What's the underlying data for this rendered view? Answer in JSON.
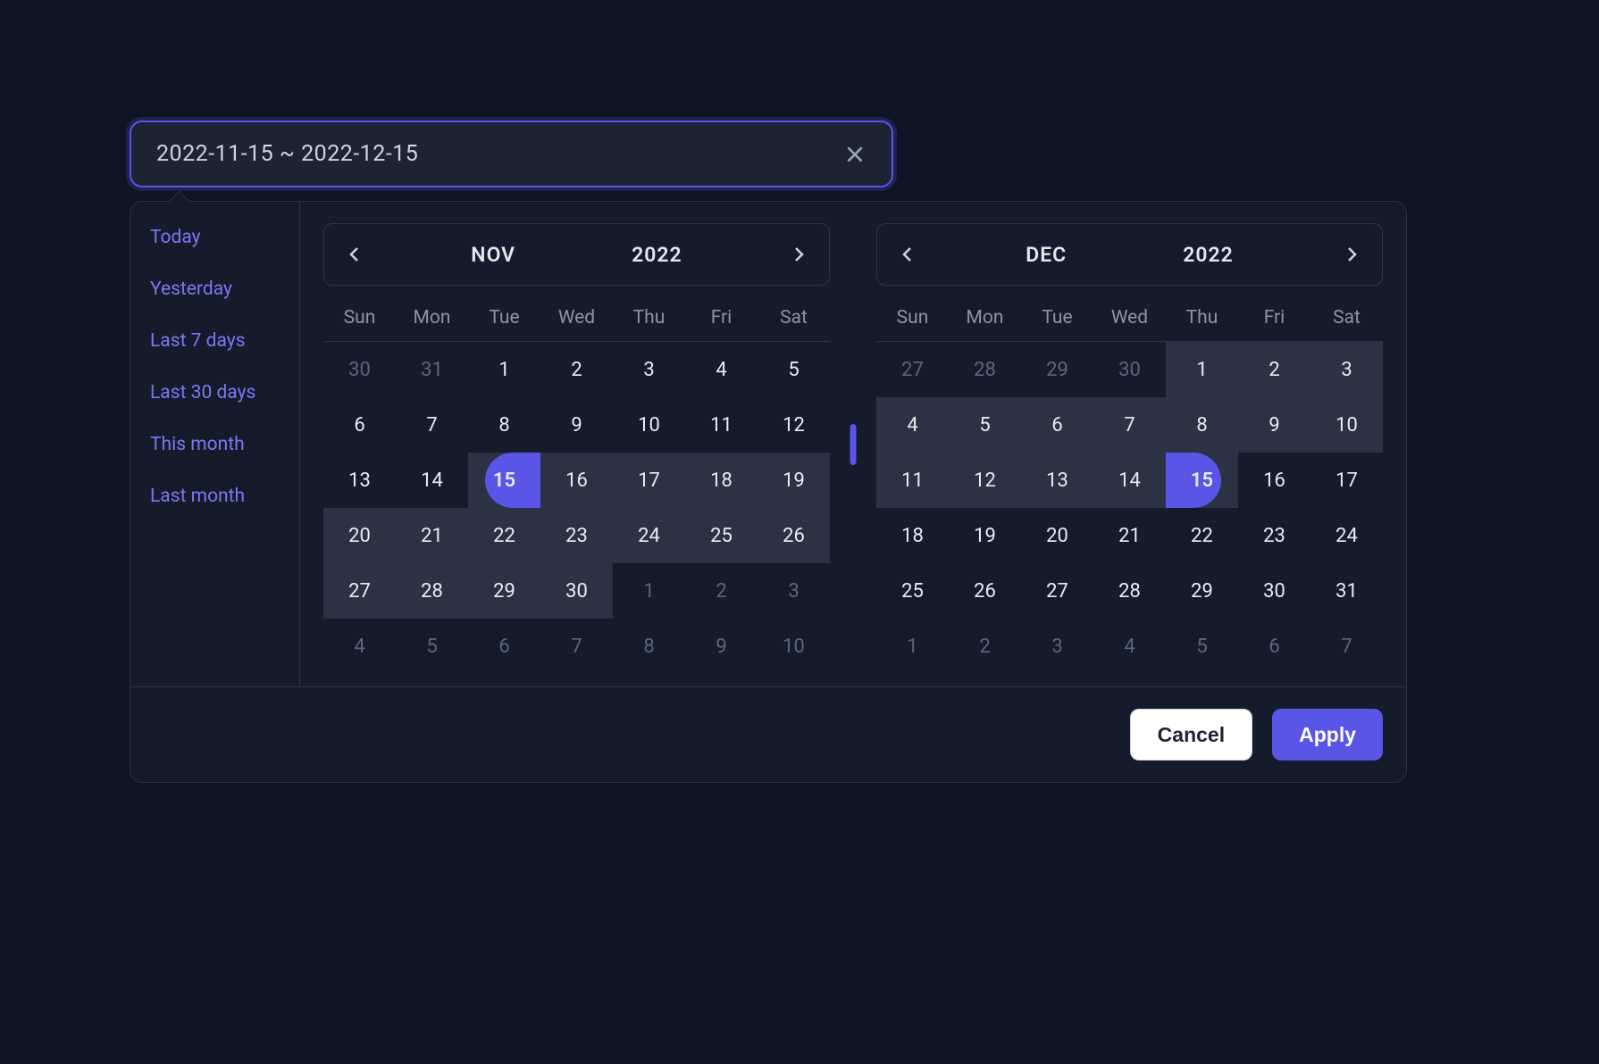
{
  "input": {
    "value": "2022-11-15 ~ 2022-12-15"
  },
  "shortcuts": [
    "Today",
    "Yesterday",
    "Last 7 days",
    "Last 30 days",
    "This month",
    "Last month"
  ],
  "dow": [
    "Sun",
    "Mon",
    "Tue",
    "Wed",
    "Thu",
    "Fri",
    "Sat"
  ],
  "calendars": [
    {
      "month": "NOV",
      "year": "2022",
      "cells": [
        {
          "n": "30",
          "o": true
        },
        {
          "n": "31",
          "o": true
        },
        {
          "n": "1"
        },
        {
          "n": "2"
        },
        {
          "n": "3"
        },
        {
          "n": "4"
        },
        {
          "n": "5"
        },
        {
          "n": "6"
        },
        {
          "n": "7"
        },
        {
          "n": "8"
        },
        {
          "n": "9"
        },
        {
          "n": "10"
        },
        {
          "n": "11"
        },
        {
          "n": "12"
        },
        {
          "n": "13"
        },
        {
          "n": "14"
        },
        {
          "n": "15",
          "start": true
        },
        {
          "n": "16",
          "r": true
        },
        {
          "n": "17",
          "r": true
        },
        {
          "n": "18",
          "r": true
        },
        {
          "n": "19",
          "r": true
        },
        {
          "n": "20",
          "r": true
        },
        {
          "n": "21",
          "r": true
        },
        {
          "n": "22",
          "r": true
        },
        {
          "n": "23",
          "r": true
        },
        {
          "n": "24",
          "r": true
        },
        {
          "n": "25",
          "r": true
        },
        {
          "n": "26",
          "r": true
        },
        {
          "n": "27",
          "r": true
        },
        {
          "n": "28",
          "r": true
        },
        {
          "n": "29",
          "r": true
        },
        {
          "n": "30",
          "r": true
        },
        {
          "n": "1",
          "o": true
        },
        {
          "n": "2",
          "o": true
        },
        {
          "n": "3",
          "o": true
        },
        {
          "n": "4",
          "o": true
        },
        {
          "n": "5",
          "o": true
        },
        {
          "n": "6",
          "o": true
        },
        {
          "n": "7",
          "o": true
        },
        {
          "n": "8",
          "o": true
        },
        {
          "n": "9",
          "o": true
        },
        {
          "n": "10",
          "o": true
        }
      ]
    },
    {
      "month": "DEC",
      "year": "2022",
      "cells": [
        {
          "n": "27",
          "o": true
        },
        {
          "n": "28",
          "o": true
        },
        {
          "n": "29",
          "o": true
        },
        {
          "n": "30",
          "o": true
        },
        {
          "n": "1",
          "r": true
        },
        {
          "n": "2",
          "r": true
        },
        {
          "n": "3",
          "r": true
        },
        {
          "n": "4",
          "r": true
        },
        {
          "n": "5",
          "r": true
        },
        {
          "n": "6",
          "r": true
        },
        {
          "n": "7",
          "r": true
        },
        {
          "n": "8",
          "r": true
        },
        {
          "n": "9",
          "r": true
        },
        {
          "n": "10",
          "r": true
        },
        {
          "n": "11",
          "r": true
        },
        {
          "n": "12",
          "r": true
        },
        {
          "n": "13",
          "r": true
        },
        {
          "n": "14",
          "r": true
        },
        {
          "n": "15",
          "end": true
        },
        {
          "n": "16"
        },
        {
          "n": "17"
        },
        {
          "n": "18"
        },
        {
          "n": "19"
        },
        {
          "n": "20"
        },
        {
          "n": "21"
        },
        {
          "n": "22"
        },
        {
          "n": "23"
        },
        {
          "n": "24"
        },
        {
          "n": "25"
        },
        {
          "n": "26"
        },
        {
          "n": "27"
        },
        {
          "n": "28"
        },
        {
          "n": "29"
        },
        {
          "n": "30"
        },
        {
          "n": "31"
        },
        {
          "n": "1",
          "o": true
        },
        {
          "n": "2",
          "o": true
        },
        {
          "n": "3",
          "o": true
        },
        {
          "n": "4",
          "o": true
        },
        {
          "n": "5",
          "o": true
        },
        {
          "n": "6",
          "o": true
        },
        {
          "n": "7",
          "o": true
        }
      ]
    }
  ],
  "buttons": {
    "cancel": "Cancel",
    "apply": "Apply"
  }
}
